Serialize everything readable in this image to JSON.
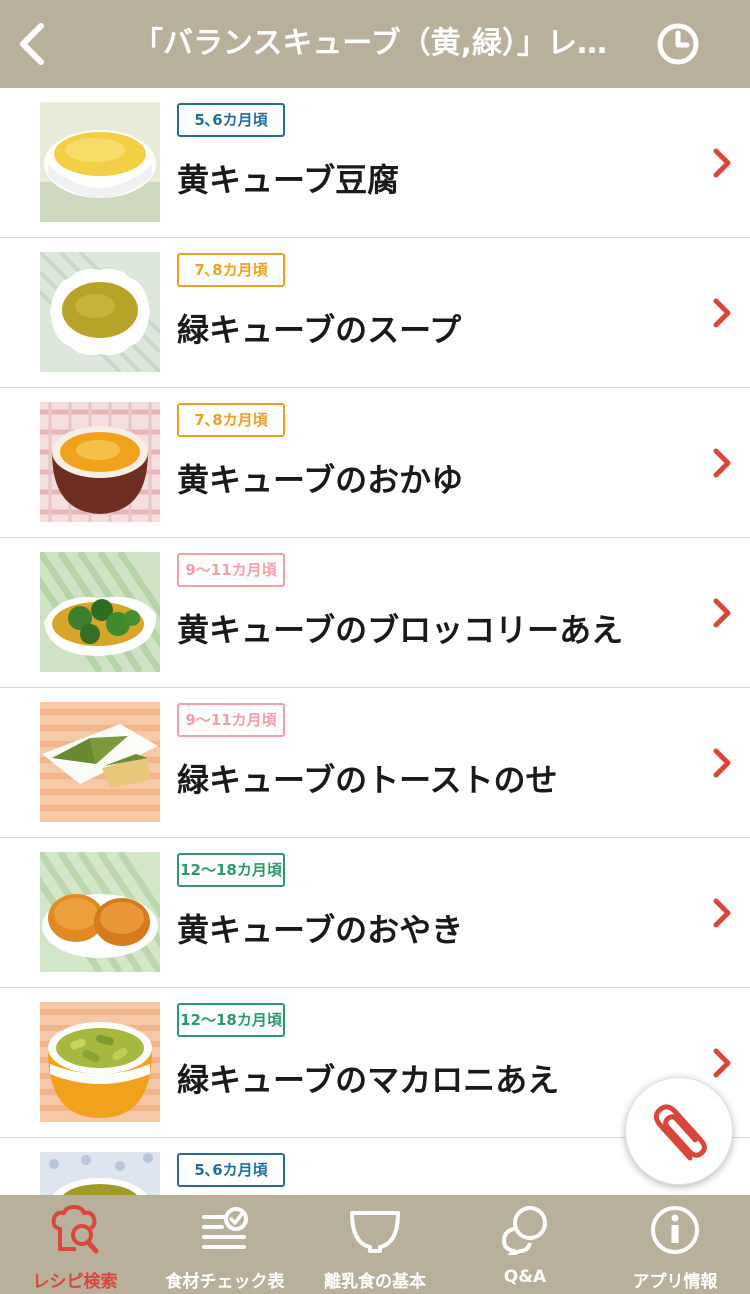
{
  "header": {
    "title": "「バランスキューブ（黄,緑）」レ…"
  },
  "colors": {
    "header_bg": "#b9b09c",
    "accent_red": "#d9463c",
    "badge_5_6": "#1f6f98",
    "badge_7_8": "#f0a020",
    "badge_9_11": "#f2a0a6",
    "badge_12_18": "#2c9a68"
  },
  "recipes": [
    {
      "age": "5､6カ月頃",
      "name": "黄キューブ豆腐",
      "age_color": "#1f6f98",
      "icon": "yellow-tofu-photo"
    },
    {
      "age": "7､8カ月頃",
      "name": "緑キューブのスープ",
      "age_color": "#f0a020",
      "icon": "green-soup-photo"
    },
    {
      "age": "7､8カ月頃",
      "name": "黄キューブのおかゆ",
      "age_color": "#f0a020",
      "icon": "yellow-porridge-photo"
    },
    {
      "age": "9～11カ月頃",
      "name": "黄キューブのブロッコリーあえ",
      "age_color": "#f2a0a6",
      "icon": "broccoli-dish-photo"
    },
    {
      "age": "9～11カ月頃",
      "name": "緑キューブのトーストのせ",
      "age_color": "#f2a0a6",
      "icon": "green-toast-photo"
    },
    {
      "age": "12～18カ月頃",
      "name": "黄キューブのおやき",
      "age_color": "#2c9a68",
      "icon": "oyaki-photo"
    },
    {
      "age": "12～18カ月頃",
      "name": "緑キューブのマカロニあえ",
      "age_color": "#2c9a68",
      "icon": "macaroni-photo"
    },
    {
      "age": "5､6カ月頃",
      "name": "",
      "age_color": "#1f6f98",
      "icon": "green-soup-cup-photo"
    }
  ],
  "tabs": [
    {
      "label": "レシピ検索",
      "icon": "recipe-search-icon",
      "active": true
    },
    {
      "label": "食材チェック表",
      "icon": "ingredient-check-icon",
      "active": false
    },
    {
      "label": "離乳食の基本",
      "icon": "bowl-icon",
      "active": false
    },
    {
      "label": "Q&A",
      "icon": "qa-bubbles-icon",
      "active": false
    },
    {
      "label": "アプリ情報",
      "icon": "info-icon",
      "active": false
    }
  ]
}
